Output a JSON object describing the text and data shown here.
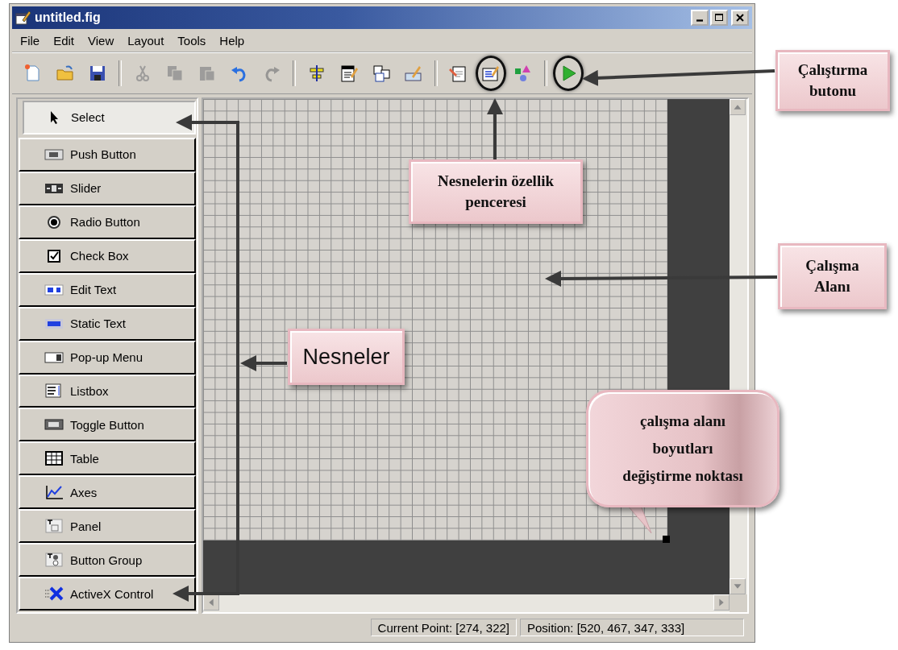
{
  "window": {
    "title": "untitled.fig"
  },
  "menu": [
    {
      "label": "File"
    },
    {
      "label": "Edit"
    },
    {
      "label": "View"
    },
    {
      "label": "Layout"
    },
    {
      "label": "Tools"
    },
    {
      "label": "Help"
    }
  ],
  "toolbar_groups": [
    {
      "buttons": [
        {
          "kind": "new",
          "disabled": false,
          "circled": false
        },
        {
          "kind": "open",
          "disabled": false,
          "circled": false
        },
        {
          "kind": "save",
          "disabled": false,
          "circled": false
        }
      ]
    },
    {
      "buttons": [
        {
          "kind": "cut",
          "disabled": true,
          "circled": false
        },
        {
          "kind": "copy",
          "disabled": true,
          "circled": false
        },
        {
          "kind": "paste",
          "disabled": true,
          "circled": false
        },
        {
          "kind": "undo",
          "disabled": false,
          "circled": false
        },
        {
          "kind": "redo",
          "disabled": true,
          "circled": false
        }
      ]
    },
    {
      "buttons": [
        {
          "kind": "align",
          "disabled": false,
          "circled": false
        },
        {
          "kind": "menu-editor",
          "disabled": false,
          "circled": false
        },
        {
          "kind": "tab-order",
          "disabled": false,
          "circled": false
        },
        {
          "kind": "toolbar-editor",
          "disabled": false,
          "circled": false
        }
      ]
    },
    {
      "buttons": [
        {
          "kind": "editor",
          "disabled": false,
          "circled": false
        },
        {
          "kind": "inspector",
          "disabled": false,
          "circled": true
        },
        {
          "kind": "browser",
          "disabled": false,
          "circled": false
        }
      ]
    },
    {
      "buttons": [
        {
          "kind": "run",
          "disabled": false,
          "circled": true
        }
      ]
    }
  ],
  "palette": [
    {
      "label": "Select",
      "kind": "select",
      "selected": true
    },
    {
      "label": "Push Button",
      "kind": "push",
      "selected": false
    },
    {
      "label": "Slider",
      "kind": "slider",
      "selected": false
    },
    {
      "label": "Radio Button",
      "kind": "radio",
      "selected": false
    },
    {
      "label": "Check Box",
      "kind": "check",
      "selected": false
    },
    {
      "label": "Edit Text",
      "kind": "edit",
      "selected": false
    },
    {
      "label": "Static Text",
      "kind": "static",
      "selected": false
    },
    {
      "label": "Pop-up Menu",
      "kind": "popup",
      "selected": false
    },
    {
      "label": "Listbox",
      "kind": "listbox",
      "selected": false
    },
    {
      "label": "Toggle Button",
      "kind": "toggle",
      "selected": false
    },
    {
      "label": "Table",
      "kind": "table",
      "selected": false
    },
    {
      "label": "Axes",
      "kind": "axes",
      "selected": false
    },
    {
      "label": "Panel",
      "kind": "panel",
      "selected": false
    },
    {
      "label": "Button Group",
      "kind": "group",
      "selected": false
    },
    {
      "label": "ActiveX Control",
      "kind": "activex",
      "selected": false
    }
  ],
  "status_bar": {
    "current_point": "Current Point:  [274, 322]",
    "position": "Position: [520, 467, 347, 333]"
  },
  "callouts": [
    {
      "kind": "box",
      "lines": [
        "Çalıştırma",
        "butonu"
      ]
    },
    {
      "kind": "box",
      "lines": [
        "Nesnelerin özellik",
        "penceresi"
      ]
    },
    {
      "kind": "box",
      "lines": [
        "Çalışma",
        "Alanı"
      ]
    },
    {
      "kind": "plain-box",
      "lines": [
        "Nesneler"
      ]
    },
    {
      "kind": "bubble",
      "lines": [
        "çalışma alanı",
        "boyutları",
        "değiştirme noktası"
      ]
    }
  ]
}
